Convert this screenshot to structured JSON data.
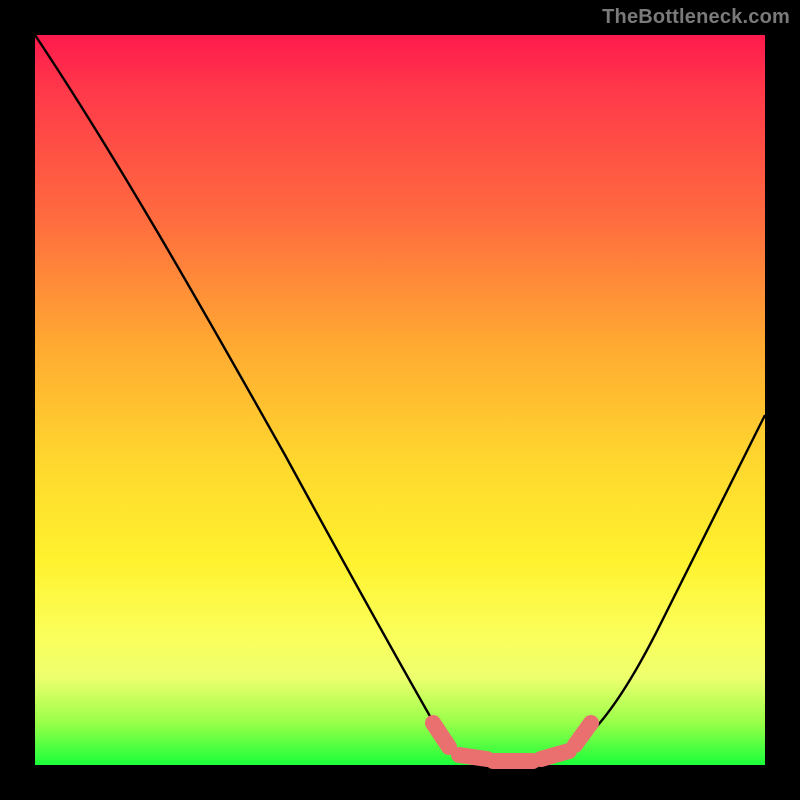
{
  "watermark": "TheBottleneck.com",
  "chart_data": {
    "type": "line",
    "title": "",
    "xlabel": "",
    "ylabel": "",
    "xlim": [
      0,
      100
    ],
    "ylim": [
      0,
      100
    ],
    "grid": false,
    "series": [
      {
        "name": "bottleneck-curve",
        "x": [
          0,
          12,
          24,
          36,
          48,
          55,
          60,
          65,
          70,
          75,
          82,
          90,
          100
        ],
        "values": [
          100,
          82,
          64,
          46,
          28,
          14,
          4,
          1,
          1,
          3,
          12,
          30,
          55
        ]
      }
    ],
    "annotations": [
      {
        "name": "optimal-marker",
        "x_range": [
          55,
          75
        ],
        "y": 1
      }
    ],
    "background_gradient": {
      "stops": [
        {
          "pos": 0,
          "color": "#ff1a4d"
        },
        {
          "pos": 25,
          "color": "#ff6b3f"
        },
        {
          "pos": 58,
          "color": "#ffd62e"
        },
        {
          "pos": 88,
          "color": "#eeff6e"
        },
        {
          "pos": 100,
          "color": "#1aff3a"
        }
      ]
    }
  }
}
